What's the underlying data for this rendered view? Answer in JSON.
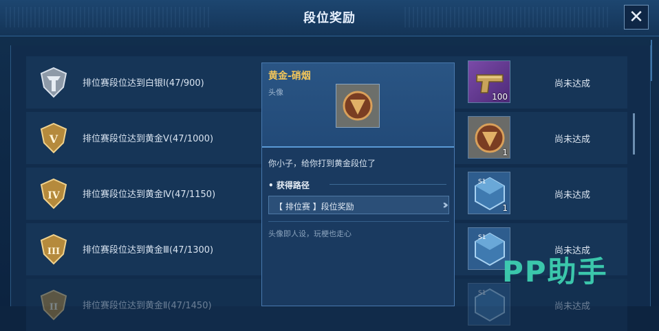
{
  "window": {
    "title": "段位奖励",
    "close_label": "✕"
  },
  "rows": [
    {
      "badge_numeral": "I",
      "text": "排位赛段位达到白银Ⅰ(47/900)",
      "reward_qty": "100",
      "reward_icon": "pistol-icon",
      "status": "尚未达成"
    },
    {
      "badge_numeral": "V",
      "text": "排位赛段位达到黄金Ⅴ(47/1000)",
      "reward_qty": "1",
      "reward_icon": "avatar-frame-icon",
      "status": "尚未达成"
    },
    {
      "badge_numeral": "IV",
      "text": "排位赛段位达到黄金Ⅳ(47/1150)",
      "reward_qty": "1",
      "reward_icon": "crate-icon",
      "status": "尚未达成"
    },
    {
      "badge_numeral": "III",
      "text": "排位赛段位达到黄金Ⅲ(47/1300)",
      "reward_qty": "",
      "reward_icon": "crate-icon",
      "status": "尚未达成"
    },
    {
      "badge_numeral": "II",
      "text": "排位赛段位达到黄金Ⅱ(47/1450)",
      "reward_qty": "",
      "reward_icon": "crate-icon",
      "status": "尚未达成"
    }
  ],
  "popup": {
    "title": "黄金-硝烟",
    "subtitle": "头像",
    "description": "你小子，给你打到黄金段位了",
    "source_heading": "• 获得路径",
    "source_button": "【 排位赛 】段位奖励",
    "note": "头像即人设，玩梗也走心"
  },
  "watermark": "PP助手",
  "colors": {
    "accent_gold": "#f2c55a",
    "background": "#0d2440",
    "watermark": "#3fd3b3"
  }
}
